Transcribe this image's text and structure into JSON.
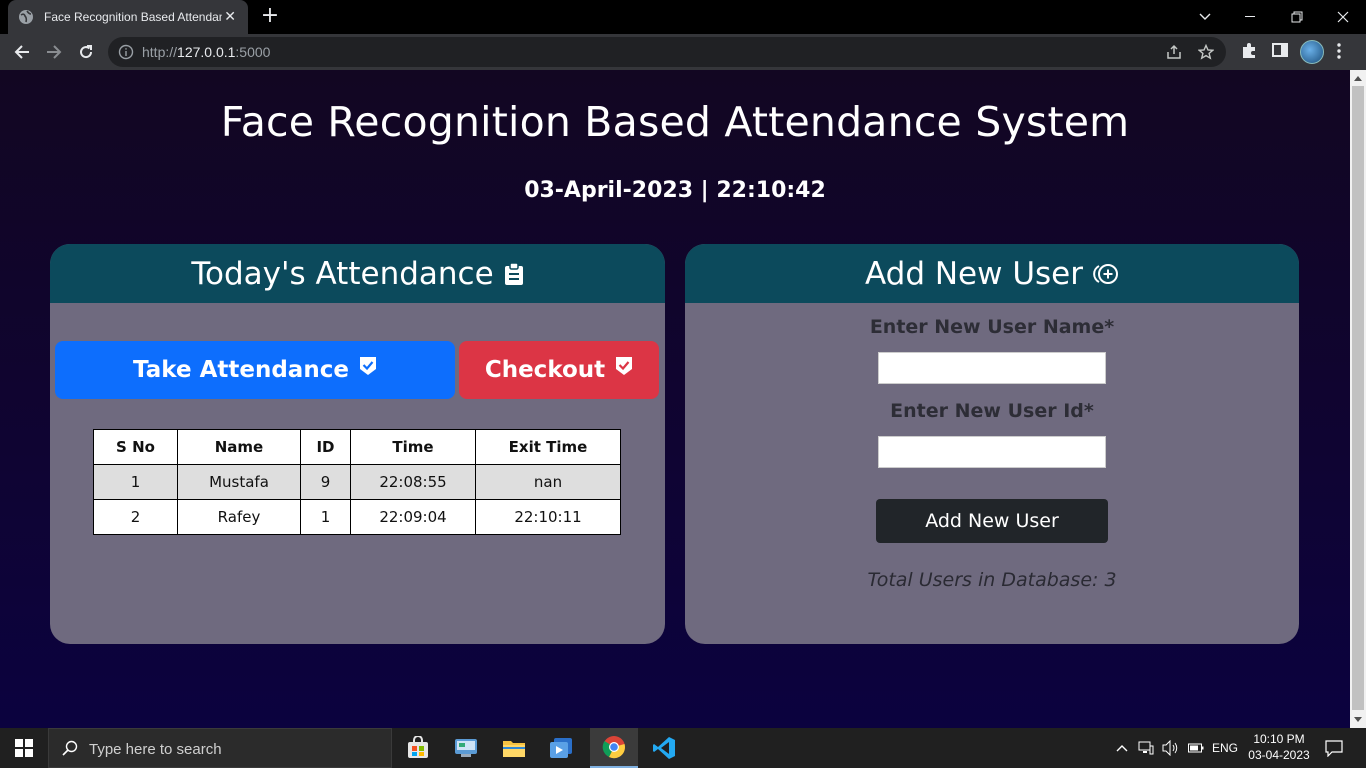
{
  "browser": {
    "tab_title": "Face Recognition Based Attendance System",
    "tab_close": "✕",
    "new_tab": "+",
    "url_host": "127.0.0.1",
    "url_prefix": "http://",
    "url_port": ":5000"
  },
  "page": {
    "title": "Face Recognition Based Attendance System",
    "datetime": "03-April-2023 | 22:10:42"
  },
  "attendance_panel": {
    "header": "Today's Attendance",
    "header_icon": "clipboard-icon",
    "take_attendance_label": "Take Attendance",
    "checkout_label": "Checkout",
    "button_icon": "check-shield-icon",
    "table": {
      "columns": [
        "S No",
        "Name",
        "ID",
        "Time",
        "Exit Time"
      ],
      "rows": [
        [
          "1",
          "Mustafa",
          "9",
          "22:08:55",
          "nan"
        ],
        [
          "2",
          "Rafey",
          "1",
          "22:09:04",
          "22:10:11"
        ]
      ]
    }
  },
  "add_user_panel": {
    "header": "Add New User",
    "header_icon": "add-circle-icon",
    "name_label": "Enter New User Name*",
    "name_value": "",
    "id_label": "Enter New User Id*",
    "id_value": "",
    "submit_label": "Add New User",
    "total_users": "Total Users in Database: 3"
  },
  "taskbar": {
    "search_placeholder": "Type here to search",
    "language": "ENG",
    "time": "10:10 PM",
    "date": "03-04-2023"
  },
  "colors": {
    "header_bg": "#0c4a5c",
    "panel_bg": "#6f6a7f",
    "take_btn": "#0d6efd",
    "checkout_btn": "#dc3545",
    "add_btn": "#212529"
  }
}
